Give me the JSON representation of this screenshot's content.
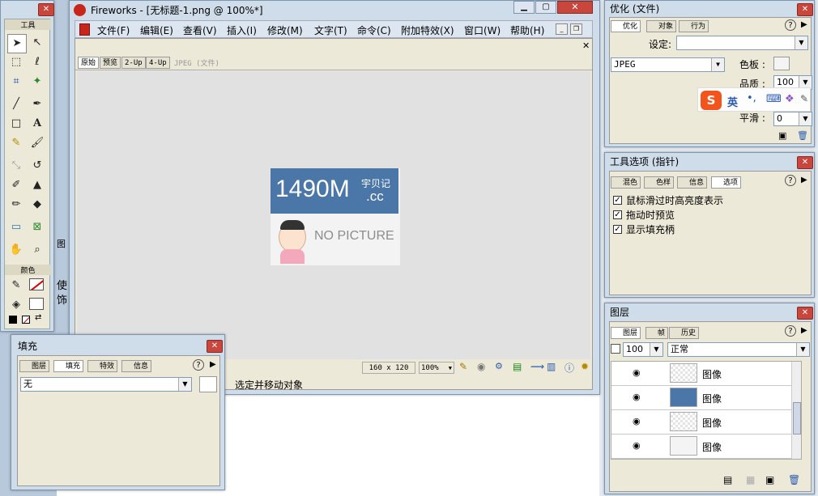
{
  "tools_panel": {
    "title": "工具",
    "colors_label": "颜色"
  },
  "main_window": {
    "title": "Fireworks - [无标题-1.png @  100%*]",
    "menu": [
      "文件(F)",
      "编辑(E)",
      "查看(V)",
      "插入(I)",
      "修改(M)",
      "文字(T)",
      "命令(C)",
      "附加特效(X)",
      "窗口(W)",
      "帮助(H)"
    ],
    "view_tabs": [
      "原始",
      "预览",
      "2-Up",
      "4-Up"
    ],
    "view_tab_hint": "JPEG (文件)",
    "canvas_image": {
      "brand": "1490M",
      "brand_suffix": ".cc",
      "brand_cn": "宇贝记",
      "placeholder": "NO PICTURE"
    },
    "status": {
      "size": "160 x 120",
      "zoom": "100%"
    },
    "status_message": "选定并移动对象"
  },
  "optimize_panel": {
    "title": "优化 (文件)",
    "tabs": [
      "优化",
      "对象",
      "行为"
    ],
    "settings_label": "设定:",
    "settings_value": "",
    "format": "JPEG",
    "matte_label": "色板 :",
    "quality_label": "品质 :",
    "quality_value": "100",
    "smoothing_label": "平滑 :",
    "smoothing_value": "0",
    "ime_lang": "英"
  },
  "tool_options_panel": {
    "title": "工具选项 (指针)",
    "tabs": [
      "混色",
      "色样",
      "信息",
      "选项"
    ],
    "options": [
      {
        "label": "鼠标滑过时高亮度表示",
        "checked": true
      },
      {
        "label": "拖动时预览",
        "checked": true
      },
      {
        "label": "显示填充柄",
        "checked": true
      }
    ]
  },
  "layers_panel": {
    "title": "图层",
    "tabs": [
      "图层",
      "帧",
      "历史"
    ],
    "opacity": "100",
    "blend_mode": "正常",
    "layers": [
      {
        "name": "图像"
      },
      {
        "name": "图像"
      },
      {
        "name": "图像"
      },
      {
        "name": "图像"
      }
    ]
  },
  "fill_panel": {
    "title": "填充",
    "tabs": [
      "图层",
      "填充",
      "特效",
      "信息"
    ],
    "fill_type": "无"
  },
  "background_fragments": [
    "使",
    "饰",
    "图"
  ]
}
